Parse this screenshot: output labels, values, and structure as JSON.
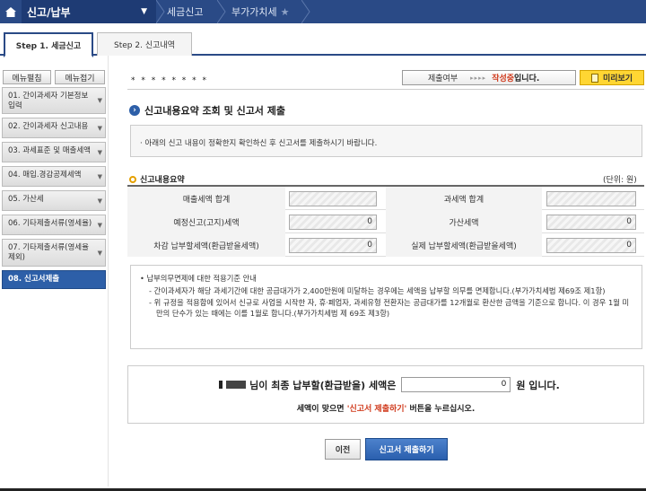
{
  "topbar": {
    "menu_title": "신고/납부",
    "crumb_tax_return": "세금신고",
    "crumb_vat": "부가가치세"
  },
  "steps": {
    "step1": "Step 1. 세금신고",
    "step2": "Step 2. 신고내역"
  },
  "sidebar": {
    "expand_label": "메뉴펼침",
    "collapse_label": "메뉴접기",
    "items": [
      {
        "label": "01. 간이과세자 기본정보 입력"
      },
      {
        "label": "02. 간이과세자 신고내용"
      },
      {
        "label": "03. 과세표준 및 매출세액"
      },
      {
        "label": "04. 매입.경감공제세액"
      },
      {
        "label": "05. 가산세"
      },
      {
        "label": "06. 기타제출서류(영세율)"
      },
      {
        "label": "07. 기타제출서류(영세율 제외)"
      },
      {
        "label": "08. 신고서제출"
      }
    ]
  },
  "header": {
    "user_masked": "* *   * * * * * *",
    "status_label": "제출여부",
    "status_arrows": "▸▸▸▸",
    "status_value": "작성중",
    "status_tail": "입니다.",
    "preview_label": "미리보기"
  },
  "main": {
    "section_title": "신고내용요약 조회 및 신고서 제출",
    "notice": "· 아래의 신고 내용이 정확한지 확인하신 후 신고서를 제출하시기 바랍니다.",
    "summary_title": "신고내용요약",
    "unit": "(단위: 원)",
    "summary_rows": [
      {
        "left_label": "매출세액 합계",
        "left_value": "",
        "right_label": "과세액 합계",
        "right_value": ""
      },
      {
        "left_label": "예정신고(고지)세액",
        "left_value": "0",
        "right_label": "가산세액",
        "right_value": "0"
      },
      {
        "left_label": "차감 납부할세액(환급받을세액)",
        "left_value": "0",
        "right_label": "실제 납부할세액(환급받을세액)",
        "right_value": "0"
      }
    ],
    "guide": {
      "title": "• 납부의무면제에 대한 적용기준 안내",
      "item1": "- 간이과세자가 해당 과세기간에 대한 공급대가가 2,400만원에 미달하는 경우에는 세액을 납부할 의무를 면제합니다.(부가가치세법 제69조 제1항)",
      "item2": "- 위 규정을 적용함에 있어서 신규로 사업을 시작한 자, 휴·폐업자, 과세유형 전환자는 공급대가를 12개월로 환산한 금액을 기준으로 합니다. 이 경우 1월 미만의 단수가 있는 때에는 이를 1월로 합니다.(부가가치세법 제 69조 제3항)"
    },
    "final": {
      "prefix": "님이 최종 납부할(환급받을) 세액은",
      "amount": "0",
      "suffix": "원 입니다.",
      "confirm_pre": "세액이 맞으면 ",
      "confirm_red": "'신고서 제출하기'",
      "confirm_post": " 버튼을 누르십시오."
    },
    "prev_button": "이전",
    "submit_button": "신고서 제출하기"
  }
}
